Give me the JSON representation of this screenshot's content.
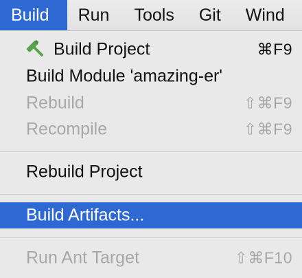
{
  "menubar": {
    "items": [
      {
        "label": "Build"
      },
      {
        "label": "Run"
      },
      {
        "label": "Tools"
      },
      {
        "label": "Git"
      },
      {
        "label": "Wind"
      }
    ]
  },
  "menu": {
    "items": [
      {
        "label": "Build Project",
        "shortcut": "⌘F9",
        "enabled": true,
        "icon": "hammer-icon"
      },
      {
        "label": "Build Module 'amazing-er'",
        "shortcut": "",
        "enabled": true
      },
      {
        "label": "Rebuild",
        "shortcut": "⇧⌘F9",
        "enabled": false
      },
      {
        "label": "Recompile",
        "shortcut": "⇧⌘F9",
        "enabled": false
      },
      {
        "label": "Rebuild Project",
        "shortcut": "",
        "enabled": true
      },
      {
        "label": "Build Artifacts...",
        "shortcut": "",
        "enabled": true,
        "highlighted": true
      },
      {
        "label": "Run Ant Target",
        "shortcut": "⇧⌘F10",
        "enabled": false
      }
    ]
  },
  "colors": {
    "highlight": "#2e69d3",
    "hammer": "#5aa34a",
    "disabled_text": "#a8a8a8"
  }
}
